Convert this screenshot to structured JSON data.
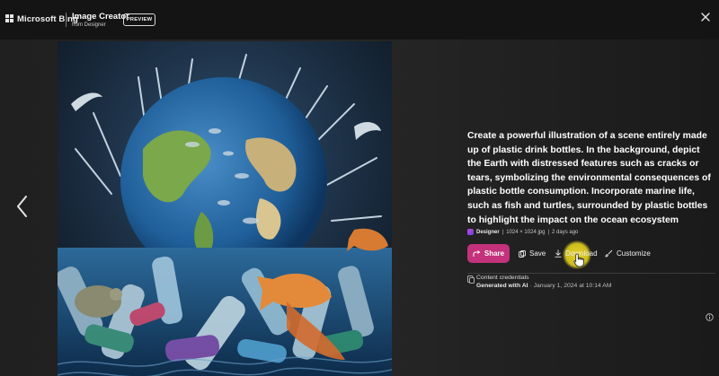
{
  "header": {
    "brand": "Microsoft Bing",
    "app_title": "Image Creator",
    "app_subtitle": "from Designer",
    "badge": "PREVIEW"
  },
  "navigation": {
    "prev_icon": "chevron-left-icon",
    "close_icon": "close-icon"
  },
  "image": {
    "alt": "Illustration of Earth surrounded by plastic bottles, fish and turtles",
    "resolution": "1024 × 1024 jpg"
  },
  "details": {
    "prompt": "Create a powerful illustration of a scene entirely made up of plastic drink bottles. In the background, depict the Earth with distressed features such as cracks or tears, symbolizing the environmental consequences of plastic bottle consumption. Incorporate marine life, such as fish and turtles, surrounded by plastic bottles to highlight the impact on the ocean ecosystem",
    "creator": "Designer",
    "resolution": "1024 × 1024 jpg",
    "age": "2 days ago",
    "separator": "|"
  },
  "actions": {
    "share": "Share",
    "save": "Save",
    "download": "Download",
    "customize": "Customize"
  },
  "credentials": {
    "title": "Content credentials",
    "generated": "Generated with AI",
    "date": "· January 1, 2024 at 10:14 AM"
  },
  "colors": {
    "share_accent": "#c3327a",
    "cursor_highlight": "#e6d21e"
  }
}
